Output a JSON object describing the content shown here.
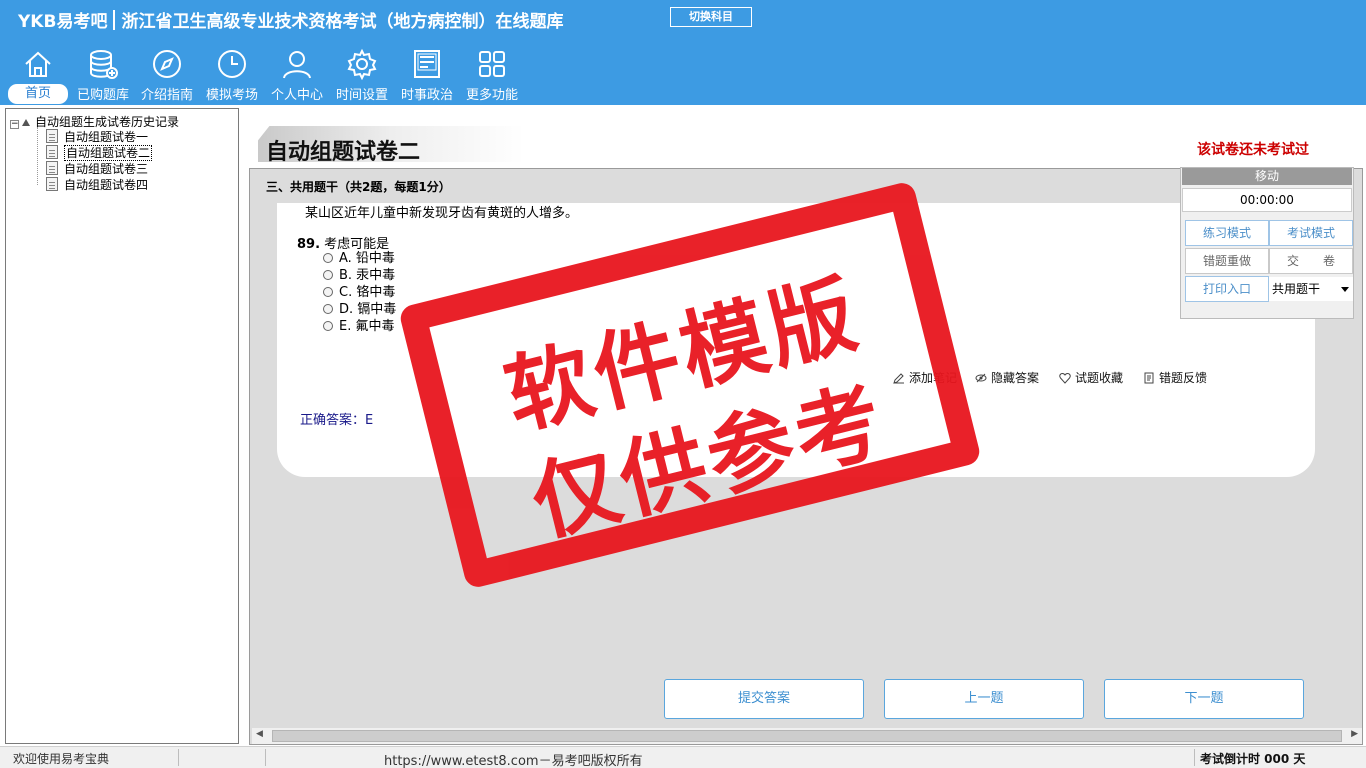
{
  "header": {
    "logo": "YKB易考吧",
    "title": "浙江省卫生高级专业技术资格考试（地方病控制）在线题库",
    "switch_label": "切换科目",
    "nav": [
      {
        "label": "首页",
        "icon": "home-icon"
      },
      {
        "label": "已购题库",
        "icon": "database-icon"
      },
      {
        "label": "介绍指南",
        "icon": "compass-icon"
      },
      {
        "label": "模拟考场",
        "icon": "clock-icon"
      },
      {
        "label": "个人中心",
        "icon": "user-icon"
      },
      {
        "label": "时间设置",
        "icon": "gear-icon"
      },
      {
        "label": "时事政治",
        "icon": "news-icon"
      },
      {
        "label": "更多功能",
        "icon": "grid-icon"
      }
    ]
  },
  "tree": {
    "root": "自动组题生成试卷历史记录",
    "items": [
      "自动组题试卷一",
      "自动组题试卷二",
      "自动组题试卷三",
      "自动组题试卷四"
    ],
    "selected_index": 1
  },
  "main": {
    "title": "自动组题试卷二",
    "status_note": "该试卷还未考试过",
    "section_title": "三、共用题干（共2题，每题1分）",
    "stem": "某山区近年儿童中新发现牙齿有黄斑的人增多。",
    "question_number": "89.",
    "question_text": "考虑可能是",
    "options": [
      "A. 铅中毒",
      "B. 汞中毒",
      "C. 铬中毒",
      "D. 镉中毒",
      "E. 氟中毒"
    ],
    "tools": {
      "add_note": "添加笔记",
      "hide_answer": "隐藏答案",
      "favorite": "试题收藏",
      "feedback": "错题反馈"
    },
    "answer_label": "正确答案：",
    "answer_value": "E",
    "buttons": {
      "submit": "提交答案",
      "prev": "上一题",
      "next": "下一题"
    }
  },
  "panel": {
    "move": "移动",
    "timer": "00:00:00",
    "practice": "练习模式",
    "exam": "考试模式",
    "redo": "错题重做",
    "submit_paper": "交　　卷",
    "print": "打印入口",
    "select_value": "共用题干"
  },
  "watermark": {
    "line1": "软件模版",
    "line2": "仅供参考"
  },
  "statusbar": {
    "welcome": "欢迎使用易考宝典",
    "copyright": "https://www.etest8.com－易考吧版权所有",
    "countdown": "考试倒计时 000 天"
  },
  "colors": {
    "header": "#3d9be3",
    "stamp": "#e8161e",
    "note": "#cc0000",
    "button_text": "#3d8fd0"
  }
}
